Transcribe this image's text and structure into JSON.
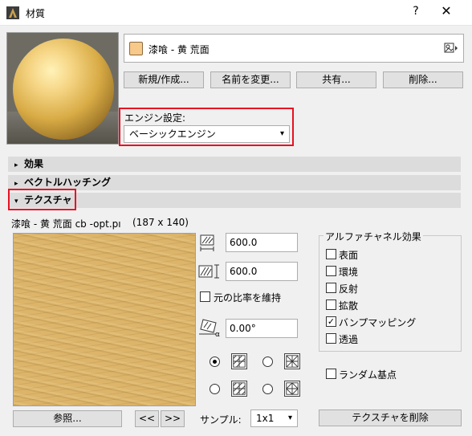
{
  "window": {
    "title": "材質",
    "help_label": "?",
    "close_label": "✕"
  },
  "material": {
    "name": "漆喰 - 黄 荒面",
    "swatch_color": "#f7c98a"
  },
  "buttons": {
    "new": "新規/作成...",
    "rename": "名前を変更...",
    "share": "共有...",
    "delete": "削除..."
  },
  "engine": {
    "label": "エンジン設定:",
    "value": "ベーシックエンジン"
  },
  "panels": {
    "effects": "効果",
    "vector_hatching": "ベクトルハッチング",
    "texture": "テクスチャ"
  },
  "texture": {
    "file_name": "漆喰 - 黄 荒面 cb -opt.pı",
    "size": "(187 x 140)",
    "width": "600.0",
    "height": "600.0",
    "keep_ratio_label": "元の比率を維持",
    "keep_ratio_checked": false,
    "angle": "0.00°",
    "random_origin_label": "ランダム基点",
    "random_origin_checked": false,
    "browse_label": "参照...",
    "prev_label": "<<",
    "next_label": ">>",
    "sample_label": "サンプル:",
    "sample_value": "1x1",
    "delete_label": "テクスチャを削除"
  },
  "alpha": {
    "title": "アルファチャネル効果",
    "items": [
      {
        "label": "表面",
        "checked": false
      },
      {
        "label": "環境",
        "checked": false
      },
      {
        "label": "反射",
        "checked": false
      },
      {
        "label": "拡散",
        "checked": false
      },
      {
        "label": "バンプマッピング",
        "checked": true
      },
      {
        "label": "透過",
        "checked": false
      }
    ]
  },
  "colors": {
    "highlight_border": "#e81123",
    "panel_header": "#dcdcdc",
    "texture_base": "#dcb46a"
  }
}
